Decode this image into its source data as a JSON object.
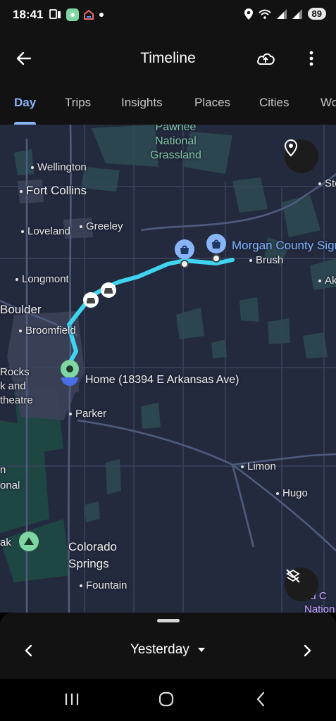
{
  "status_bar": {
    "time": "18:41",
    "battery": "89",
    "icons": [
      "notification-icon",
      "app-badge-icon",
      "home-app-icon",
      "dot-icon",
      "location-icon",
      "wifi-icon",
      "signal-icon",
      "signal-icon"
    ]
  },
  "app_bar": {
    "title": "Timeline",
    "back_icon": "arrow-back-icon",
    "cloud_icon": "cloud-backup-icon",
    "more_icon": "more-vert-icon"
  },
  "tabs": [
    {
      "label": "Day",
      "active": true
    },
    {
      "label": "Trips",
      "active": false
    },
    {
      "label": "Insights",
      "active": false
    },
    {
      "label": "Places",
      "active": false
    },
    {
      "label": "Cities",
      "active": false
    },
    {
      "label": "Wo",
      "active": false
    }
  ],
  "map": {
    "labels": {
      "pawnee": "Pawnee\nNational\nGrassland",
      "wellington": "Wellington",
      "fort_collins": "Fort Collins",
      "loveland": "Loveland",
      "greeley": "Greeley",
      "longmont": "Longmont",
      "boulder": "Boulder",
      "broomfield": "Broomfield",
      "rocks": "Rocks\nk and\ntheatre",
      "parker": "Parker",
      "limon": "Limon",
      "hugo": "Hugo",
      "colorado_springs": "Colorado\nSprings",
      "fountain": "Fountain",
      "brush": "Brush",
      "morgan": "Morgan County Sign",
      "home": "Home (18394 E Arkansas Ave)",
      "n_onal": "n\nonal",
      "peak": "ak",
      "ste": "Ste",
      "ak_right": "Ak",
      "right_purple": "nd C\nNation"
    },
    "route_color": "#3fd4f0",
    "accent_color": "#8ab4f8"
  },
  "bottom_sheet": {
    "date_label": "Yesterday",
    "prev_icon": "chevron-left-icon",
    "next_icon": "chevron-right-icon",
    "dropdown_icon": "caret-down-icon"
  },
  "nav_bar": {
    "recents_icon": "recents-icon",
    "home_icon": "home-circle-icon",
    "back_icon": "back-chevron-icon"
  }
}
